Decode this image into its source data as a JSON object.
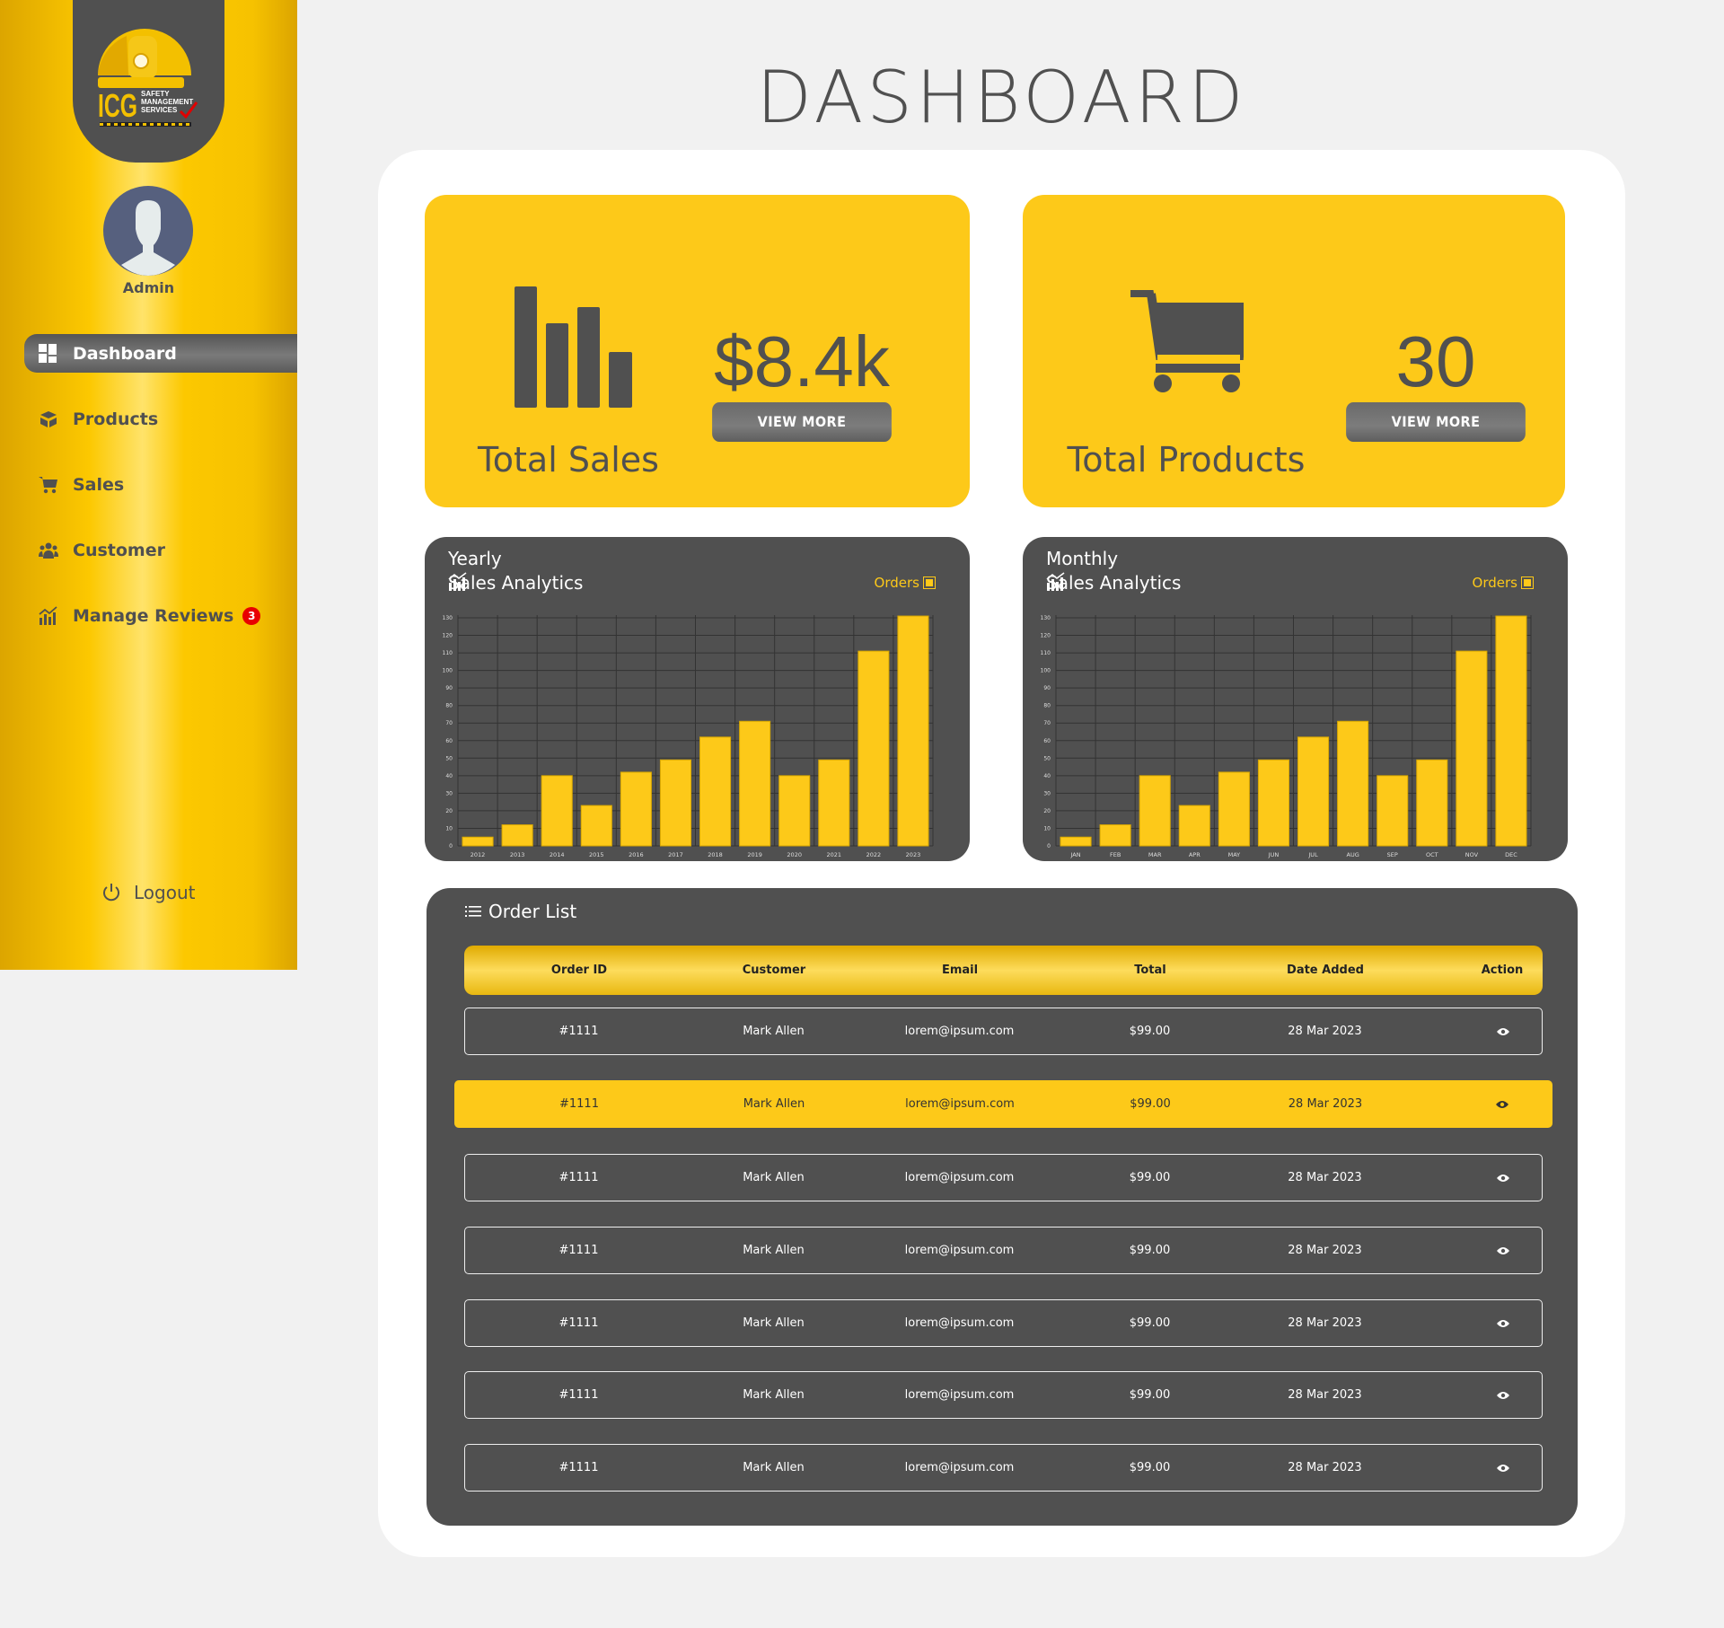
{
  "colors": {
    "accent": "#FDC919",
    "dark": "#505050",
    "background": "#F1F1F1",
    "badge": "#E80000"
  },
  "logo": {
    "text": "ICG",
    "tagline": "SAFETY MANAGEMENT SERVICES"
  },
  "user": {
    "name": "Admin"
  },
  "sidebar": {
    "items": [
      {
        "label": "Dashboard",
        "icon": "dashboard-grid-icon",
        "active": true
      },
      {
        "label": "Products",
        "icon": "box-icon"
      },
      {
        "label": "Sales",
        "icon": "cart-icon"
      },
      {
        "label": "Customer",
        "icon": "users-icon"
      },
      {
        "label": "Manage Reviews",
        "icon": "chart-icon",
        "badge": "3"
      }
    ],
    "logout": "Logout"
  },
  "header": {
    "title": "DASHBOARD"
  },
  "cards": [
    {
      "value": "$8.4k",
      "label": "Total Sales",
      "button": "VIEW MORE",
      "icon": "bar-chart-icon"
    },
    {
      "value": "30",
      "label": "Total Products",
      "button": "VIEW MORE",
      "icon": "cart-icon"
    }
  ],
  "chart_data": [
    {
      "type": "bar",
      "title_line1": "Yearly",
      "title": "Sales Analytics",
      "legend": "Orders",
      "legend_position": "top-right",
      "grid": true,
      "categories": [
        "2012",
        "2013",
        "2014",
        "2015",
        "2016",
        "2017",
        "2018",
        "2019",
        "2020",
        "2021",
        "2022",
        "2023"
      ],
      "series": [
        {
          "name": "Orders",
          "values": [
            5,
            12,
            40,
            23,
            42,
            49,
            62,
            71,
            40,
            49,
            111,
            131
          ]
        }
      ],
      "ylim": [
        0,
        130
      ],
      "yticks": [
        0,
        10,
        20,
        30,
        40,
        50,
        60,
        70,
        80,
        90,
        100,
        110,
        120,
        130
      ]
    },
    {
      "type": "bar",
      "title_line1": "Monthly",
      "title": "Sales Analytics",
      "legend": "Orders",
      "legend_position": "top-right",
      "grid": true,
      "categories": [
        "JAN",
        "FEB",
        "MAR",
        "APR",
        "MAY",
        "JUN",
        "JUL",
        "AUG",
        "SEP",
        "OCT",
        "NOV",
        "DEC"
      ],
      "series": [
        {
          "name": "Orders",
          "values": [
            5,
            12,
            40,
            23,
            42,
            49,
            62,
            71,
            40,
            49,
            111,
            131
          ]
        }
      ],
      "ylim": [
        0,
        130
      ],
      "yticks": [
        0,
        10,
        20,
        30,
        40,
        50,
        60,
        70,
        80,
        90,
        100,
        110,
        120,
        130
      ]
    }
  ],
  "orders": {
    "title": "Order List",
    "columns": [
      "Order ID",
      "Customer",
      "Email",
      "Total",
      "Date Added",
      "Action"
    ],
    "rows": [
      {
        "id": "#1111",
        "customer": "Mark Allen",
        "email": "lorem@ipsum.com",
        "total": "$99.00",
        "date": "28 Mar 2023",
        "highlighted": false
      },
      {
        "id": "#1111",
        "customer": "Mark Allen",
        "email": "lorem@ipsum.com",
        "total": "$99.00",
        "date": "28 Mar 2023",
        "highlighted": true
      },
      {
        "id": "#1111",
        "customer": "Mark Allen",
        "email": "lorem@ipsum.com",
        "total": "$99.00",
        "date": "28 Mar 2023",
        "highlighted": false
      },
      {
        "id": "#1111",
        "customer": "Mark Allen",
        "email": "lorem@ipsum.com",
        "total": "$99.00",
        "date": "28 Mar 2023",
        "highlighted": false
      },
      {
        "id": "#1111",
        "customer": "Mark Allen",
        "email": "lorem@ipsum.com",
        "total": "$99.00",
        "date": "28 Mar 2023",
        "highlighted": false
      },
      {
        "id": "#1111",
        "customer": "Mark Allen",
        "email": "lorem@ipsum.com",
        "total": "$99.00",
        "date": "28 Mar 2023",
        "highlighted": false
      },
      {
        "id": "#1111",
        "customer": "Mark Allen",
        "email": "lorem@ipsum.com",
        "total": "$99.00",
        "date": "28 Mar 2023",
        "highlighted": false
      }
    ]
  }
}
